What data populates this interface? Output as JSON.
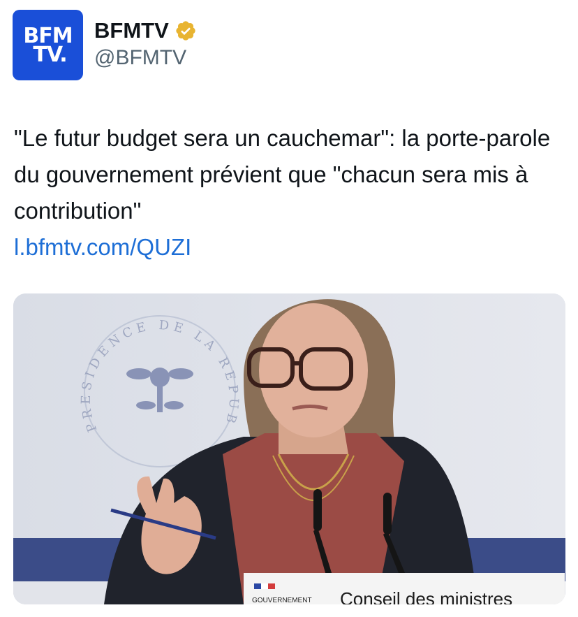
{
  "account": {
    "avatar_line1": "BFM",
    "avatar_line2": "TV.",
    "display_name": "BFMTV",
    "verified_icon": "verified-gold-badge",
    "handle": "@BFMTV"
  },
  "tweet": {
    "text": "\"Le futur budget sera un cauchemar\": la porte-parole du gouvernement prévient que \"chacun sera mis à contribution\"",
    "link": "l.bfmtv.com/QUZI"
  },
  "media": {
    "seal_text": "PRESIDENCE DE LA REPUBLIQUE",
    "podium_label_small": "GOUVERNEMENT",
    "podium_label": "Conseil des ministres"
  },
  "colors": {
    "brand_blue": "#1a4fd8",
    "link": "#1d6ed6",
    "verified_gold": "#e8b431"
  }
}
